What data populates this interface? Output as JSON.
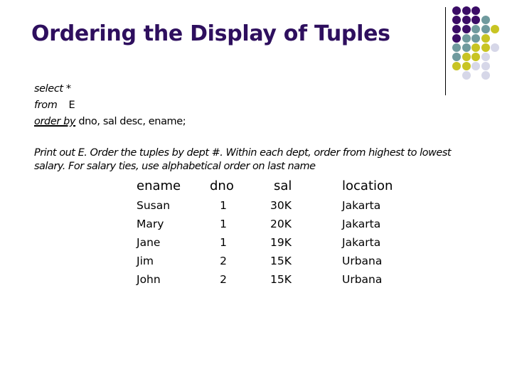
{
  "slide": {
    "title": "Ordering the Display of Tuples",
    "query": {
      "line1_kw": "select",
      "line1_rest": " *",
      "line2_kw": "from",
      "line2_rest": "E",
      "line3_kw": "order by",
      "line3_rest": " dno, sal desc, ename;"
    },
    "description": "Print out E.  Order the tuples by dept #.  Within each dept, order from highest to lowest salary.  For salary ties, use alphabetical order on last name",
    "table": {
      "columns": [
        "ename",
        "dno",
        "sal",
        "location"
      ],
      "rows": [
        [
          "Susan",
          "1",
          "30K",
          "Jakarta"
        ],
        [
          "Mary",
          "1",
          "20K",
          "Jakarta"
        ],
        [
          "Jane",
          "1",
          "19K",
          "Jakarta"
        ],
        [
          "Jim",
          "2",
          "15K",
          "Urbana"
        ],
        [
          "John",
          "2",
          "15K",
          "Urbana"
        ]
      ]
    },
    "decoration": {
      "colors": {
        "P": "#3a0c66",
        "T": "#6f9a9e",
        "Y": "#c8c423",
        "L": "#d6d7e8"
      },
      "grid": [
        "PPP",
        "PPPT",
        "PPTTY",
        "PTTY",
        "TTYYL",
        "TYYL",
        "YYLL",
        " L L"
      ]
    }
  }
}
